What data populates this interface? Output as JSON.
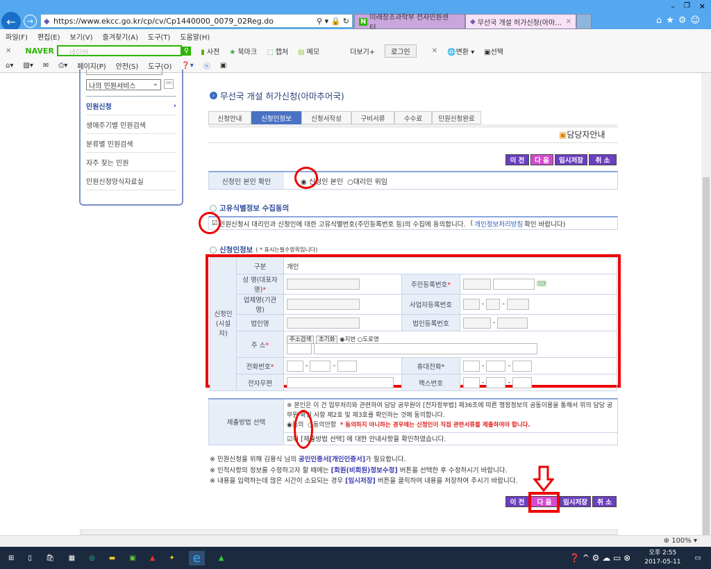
{
  "browser": {
    "url": "https://www.ekcc.go.kr/cp/cv/Cp1440000_0079_02Reg.do",
    "tabs": [
      {
        "label": "미래창조과학부 전자민원센터..."
      },
      {
        "label": "무선국 개설 허가신청(아마..."
      }
    ],
    "menu": [
      "파일(F)",
      "편집(E)",
      "보기(V)",
      "즐겨찾기(A)",
      "도구(T)",
      "도움말(H)"
    ],
    "naver": {
      "logo": "NAVER",
      "placeholder": "네이버",
      "dict": "사전",
      "bookmark": "북마크",
      "capture": "캡처",
      "memo": "메모",
      "more": "더보기+",
      "login": "로그인",
      "convert": "변환",
      "select": "선택"
    },
    "command": [
      "페이지(P)",
      "안전(S)",
      "도구(O)"
    ],
    "zoom": "100%"
  },
  "sidebar": {
    "select": "나의 민원서비스",
    "items": [
      {
        "label": "민원신청",
        "active": true
      },
      {
        "label": "생애주기별 민원검색"
      },
      {
        "label": "분류별 민원검색"
      },
      {
        "label": "자주 찾는 민원"
      },
      {
        "label": "민원신청양식자료실"
      }
    ]
  },
  "page": {
    "title": "무선국 개설 허가신청(아마추어국)",
    "steps": [
      "신청안내",
      "신청인정보",
      "신청서작성",
      "구비서류",
      "수수료",
      "민원신청완료"
    ],
    "contact": "담당자안내",
    "buttons": {
      "prev": "이 전",
      "next": "다 음",
      "save": "임시저장",
      "cancel": "취 소"
    },
    "identity": {
      "label": "신청인 본인 확인",
      "opt1": "신청인 본인",
      "opt2": "대리인 위임"
    },
    "consent": {
      "title": "고유식별정보 수집동의",
      "text": "민원신청시 대리인과 신청인에 대한 고유식별번호(주민등록번호 등)의 수집에 동의합니다.",
      "link_pre": "(",
      "link": "개인정보처리방침",
      "link_post": " 확인 바랍니다)"
    },
    "applicant": {
      "title": "신청인정보",
      "req_note": "( * 표시는필수항목입니다)",
      "group": "신청인 (시설자)",
      "type_label": "구분",
      "type_value": "개인",
      "name": "성 명(대표자명)",
      "rrn": "주민등록번호",
      "company": "업체명(기관명)",
      "bizno": "사업자등록번호",
      "corp": "법인명",
      "corpno": "법인등록번호",
      "addr": "주 소",
      "addr_search": "주소검색",
      "addr_reset": "초기화",
      "addr_jibun": "지번",
      "addr_road": "도로명",
      "phone": "전화번호",
      "mobile": "휴대전화",
      "email": "전자우편",
      "fax": "팩스번호"
    },
    "submit": {
      "label": "제출방법 선택",
      "desc": "※ 본인은 이 건 업무처리와 관련하여 담당 공무원이 [전자정부법] 제36조에 따른 행정정보의 공동이용을 통해서 위의 담당 공무원 확인 사항 제2호 및 제3호를 확인하는 것에 동의합니다.",
      "agree": "동의",
      "disagree": "동의안함",
      "warn": "* 동의하지 아니하는 경우에는 신청인이 직접 관련서류를 제출하여야 합니다.",
      "confirm": "위 [제출방법 선택] 에 대한 안내사항을 확인하였습니다."
    },
    "notes": [
      {
        "pre": "※ 민원신청을 위해 김용식 님의 ",
        "em": "공인인증서[개인인증서]",
        "post": "가 필요합니다."
      },
      {
        "pre": "※ 인적사항의 정보를 수정하고자 할 때에는 ",
        "em": "[회원(비회원)정보수정]",
        "post": " 버튼을 선택한 후 수정하시기 바랍니다."
      },
      {
        "pre": "※ 내용을 입력하는데 많은 시간이 소요되는 경우 ",
        "em": "[임시저장]",
        "post": " 버튼을 클릭하여 내용을 저장하여 주시기 바랍니다."
      }
    ]
  },
  "taskbar": {
    "time": "오후 2:55",
    "date": "2017-05-11"
  },
  "colors": {
    "annotation": "#e00000",
    "primary_button": "#6a3fc0",
    "next_button": "#d44bd0",
    "active_step": "#4a72c4"
  }
}
